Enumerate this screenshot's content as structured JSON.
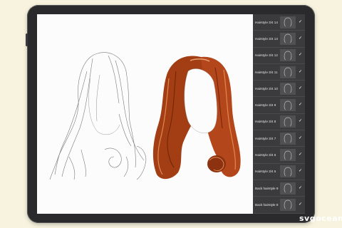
{
  "layers_panel": {
    "items": [
      {
        "label": "Hairstyle 3/4 14"
      },
      {
        "label": "Hairstyle 3/4 13"
      },
      {
        "label": "Hairstyle 3/4 12"
      },
      {
        "label": "Hairstyle 3/4 11"
      },
      {
        "label": "Hairstyle 3/4 10"
      },
      {
        "label": "Hairstyle 3/4 9"
      },
      {
        "label": "Hairstyle 3/4 8"
      },
      {
        "label": "Hairstyle 3/4 7"
      },
      {
        "label": "Hairstyle 3/4 6"
      },
      {
        "label": "Hairstyle 3/4 5"
      },
      {
        "label": "Back hairstyle 9"
      },
      {
        "label": "Back hairstyle 8"
      }
    ]
  },
  "colors": {
    "background": "#f7f3de",
    "hair_color": "#b4461c",
    "panel": "#3b3b3d"
  },
  "watermark": "svgocean"
}
